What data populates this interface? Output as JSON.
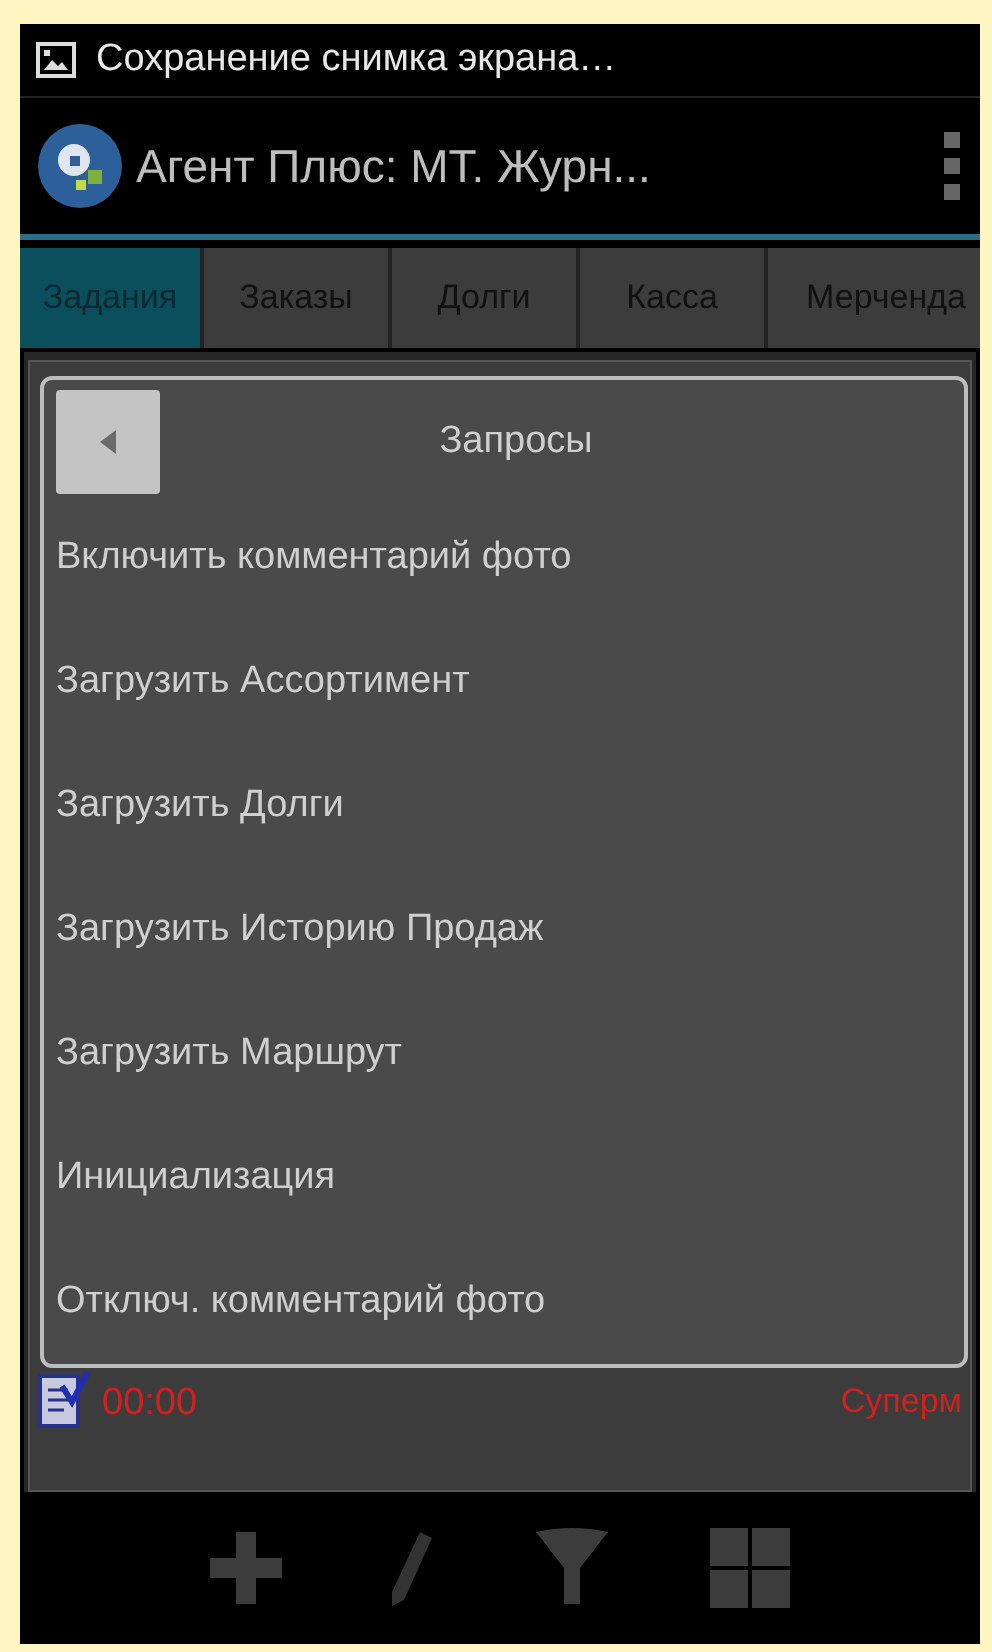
{
  "status_bar": {
    "notification": "Сохранение снимка экрана…"
  },
  "action_bar": {
    "title": "Агент Плюс: МТ. Журн..."
  },
  "tabs": [
    {
      "label": "Задания",
      "selected": true
    },
    {
      "label": "Заказы",
      "selected": false
    },
    {
      "label": "Долги",
      "selected": false
    },
    {
      "label": "Касса",
      "selected": false
    },
    {
      "label": "Мерченда",
      "selected": false
    }
  ],
  "table": {
    "rows": [
      {
        "time": "00:00",
        "column_3": "Суперм"
      }
    ]
  },
  "dialog": {
    "title": "Запросы",
    "items": [
      "Включить комментарий фото",
      "Загрузить Ассортимент",
      "Загрузить Долги",
      "Загрузить Историю Продаж",
      "Загрузить Маршрут",
      "Инициализация",
      "Отключ. комментарий фото"
    ]
  }
}
